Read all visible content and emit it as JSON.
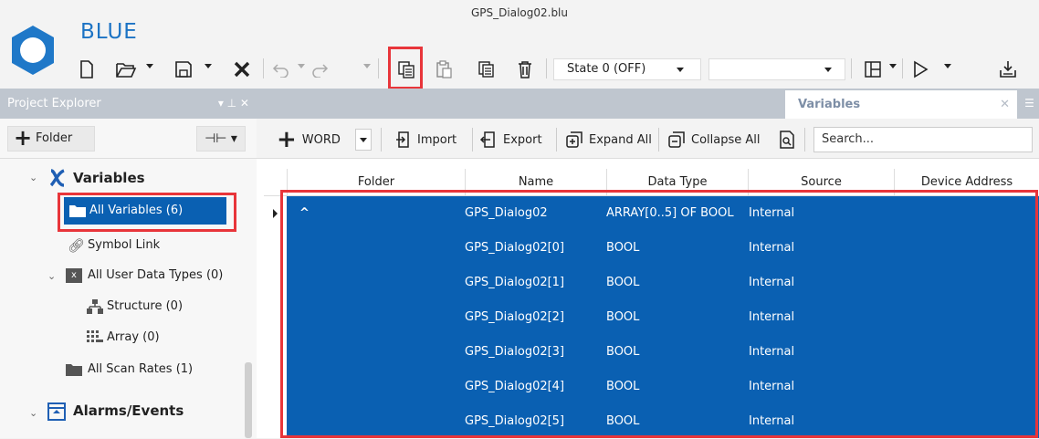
{
  "window": {
    "file_title": "GPS_Dialog02.blu",
    "app_name": "BLUE"
  },
  "toolbar": {
    "state_value": "State 0 (OFF)",
    "second_combo_value": "",
    "icons": [
      "new-file-icon",
      "open-folder-icon",
      "save-icon",
      "delete-x-icon",
      "undo-icon",
      "redo-icon",
      "copy-icon",
      "paste-icon",
      "duplicate-icon",
      "trash-icon",
      "layout-icon",
      "play-icon",
      "download-icon"
    ],
    "highlighted": "copy-icon",
    "highlight_color": "#e8353a"
  },
  "explorer": {
    "title": "Project Explorer",
    "header_icons": "▾ ⊥ ✕",
    "folder_button": "Folder",
    "pin_glyph": "⊣⊢ ▾",
    "tree": [
      {
        "label": "Variables",
        "bold": true,
        "expanded": true,
        "icon": "variables-x-icon"
      },
      {
        "label": "All Variables (6)",
        "selected": true,
        "icon": "folder-icon"
      },
      {
        "label": "Symbol Link",
        "icon": "link-icon"
      },
      {
        "label": "All User Data Types (0)",
        "expanded": true,
        "icon": "user-types-icon"
      },
      {
        "label": "Structure (0)",
        "icon": "structure-icon"
      },
      {
        "label": "Array (0)",
        "icon": "array-icon"
      },
      {
        "label": "All Scan Rates (1)",
        "icon": "folder-icon"
      },
      {
        "label": "Alarms/Events",
        "bold": true,
        "expanded": true,
        "icon": "alarms-icon"
      }
    ]
  },
  "tabs": {
    "active": "Variables"
  },
  "var_toolbar": {
    "add_type": "WORD",
    "import": "Import",
    "export": "Export",
    "expand_all": "Expand All",
    "collapse_all": "Collapse All",
    "search_placeholder": "Search..."
  },
  "grid": {
    "columns": [
      "Folder",
      "Name",
      "Data Type",
      "Source",
      "Device Address"
    ],
    "selection_color": "#0a60b2",
    "rows": [
      {
        "folder": "^",
        "name": "GPS_Dialog02",
        "type": "ARRAY[0..5] OF BOOL",
        "source": "Internal"
      },
      {
        "folder": "",
        "name": "GPS_Dialog02[0]",
        "type": "BOOL",
        "source": "Internal"
      },
      {
        "folder": "",
        "name": "GPS_Dialog02[1]",
        "type": "BOOL",
        "source": "Internal"
      },
      {
        "folder": "",
        "name": "GPS_Dialog02[2]",
        "type": "BOOL",
        "source": "Internal"
      },
      {
        "folder": "",
        "name": "GPS_Dialog02[3]",
        "type": "BOOL",
        "source": "Internal"
      },
      {
        "folder": "",
        "name": "GPS_Dialog02[4]",
        "type": "BOOL",
        "source": "Internal"
      },
      {
        "folder": "",
        "name": "GPS_Dialog02[5]",
        "type": "BOOL",
        "source": "Internal"
      }
    ]
  }
}
